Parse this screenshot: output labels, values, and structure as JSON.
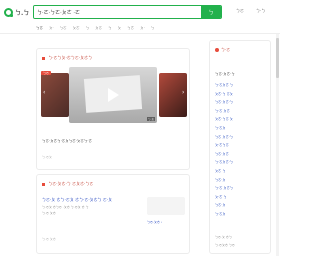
{
  "brand": {
    "logo_text": "ㄅ.ㄅ",
    "accent": "#22b14c",
    "link_color": "#1a3dbc",
    "highlight": "#e74c3c"
  },
  "search": {
    "value": "ㄅ·ㄛ·ㄅㄛ·ㄆㄜ ·ㄛ",
    "button": "ㄅ"
  },
  "top_links": [
    "ㄅㄛ",
    "ㄅ·ㄅ"
  ],
  "tabs": [
    "ㄅㄛ",
    "ㄆ·",
    "ㄅㄛ",
    "ㄆㄜ",
    "ㄅ",
    "ㄆㄛ",
    "ㄅ",
    "ㄆ",
    "ㄅㄜ",
    "ㄆ·",
    "ㄅ"
  ],
  "video_card": {
    "title": "ㄅ·ㄛㄅㄆ·ㄜㄅㄛ·ㄆㄜㄅ",
    "badge": "ㄅㄛ",
    "duration": "ㄅ:ㄆ",
    "caption": "ㄅㄛ·ㄆㄜㄅ·ㄛㄆㄅㄜ·ㄆㄛㄅ·ㄜ",
    "meta": "ㄅ·ㄛㄆ"
  },
  "result": {
    "title": "ㄅㄛ·ㄆㄜ·ㄅ ㄛㄆㄜ·ㄅㄛ",
    "line1": "ㄅㄛ·ㄆ ㄜㄅ·ㄛㄆ ㄜㄅ·ㄛ·ㄆㄜㄅ ㄛ·ㄆ",
    "line2": "ㄅ·ㄛㄆ ㄜㄅㄛ ·ㄆㄜ ㄅ·ㄛㄆ ㄜ ㄅ",
    "line3": "ㄅ·ㄛ ㄆㄜ",
    "more": "ㄅㄛ·ㄆㄜ ›",
    "source": "ㄅ·ㄛ ㄆㄜ"
  },
  "sidebar": {
    "header": "ㄅ·ㄛ",
    "title": "ㄅㄛ·ㄆㄜ·ㄅ",
    "items": [
      "ㄅ·ㄛㄆㄜ ㄅ",
      "ㄆㄜ·ㄅ ㄛㄆ",
      "ㄅㄛ·ㄆㄜ·ㄅ",
      "ㄅ·ㄛ ㄆㄜ",
      "ㄆㄜ·ㄅㄛ ㄆ",
      "ㄅ·ㄛㄆ",
      "ㄅㄛ ㄆㄜ·ㄅ",
      "ㄆ·ㄜㄅㄛ",
      "ㄅㄛ·ㄆㄜ",
      "ㄅ·ㄛㄆㄜ·ㄅ",
      "ㄆㄜ ㄅ",
      "ㄅㄛ·ㄆ",
      "ㄅ·ㄛ ㄆㄜㄅ",
      "ㄆ·ㄜ ㄅ",
      "ㄅㄛ·ㄆ",
      "ㄅ·ㄛㄆ"
    ],
    "footer1": "ㄅㄛ·ㄆ ㄜㄅ",
    "footer2": "ㄅ·ㄛㄆㄜ ㄅㄛ"
  }
}
